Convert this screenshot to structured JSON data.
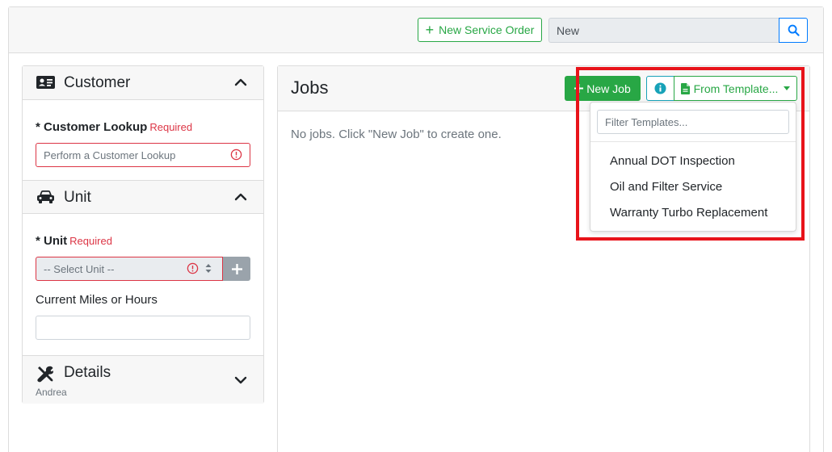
{
  "topbar": {
    "new_service_order_label": "New Service Order",
    "search_value": "New"
  },
  "customer": {
    "title": "Customer",
    "lookup_label": "* Customer Lookup",
    "required_text": "Required",
    "lookup_placeholder": "Perform a Customer Lookup"
  },
  "unit": {
    "title": "Unit",
    "unit_label": "* Unit",
    "required_text": "Required",
    "select_value": "-- Select Unit --",
    "miles_label": "Current Miles or Hours",
    "miles_value": ""
  },
  "details": {
    "title": "Details",
    "subtitle": "Andrea"
  },
  "jobs": {
    "title": "Jobs",
    "new_job_label": "New Job",
    "from_template_label": "From Template...",
    "empty_message": "No jobs. Click \"New Job\" to create one."
  },
  "template_dropdown": {
    "filter_placeholder": "Filter Templates...",
    "items": [
      {
        "label": "Annual DOT Inspection"
      },
      {
        "label": "Oil and Filter Service"
      },
      {
        "label": "Warranty Turbo Replacement"
      }
    ]
  },
  "colors": {
    "success": "#28a745",
    "primary": "#007bff",
    "danger": "#dc3545",
    "info": "#17a2b8",
    "highlight": "#e8131a"
  }
}
